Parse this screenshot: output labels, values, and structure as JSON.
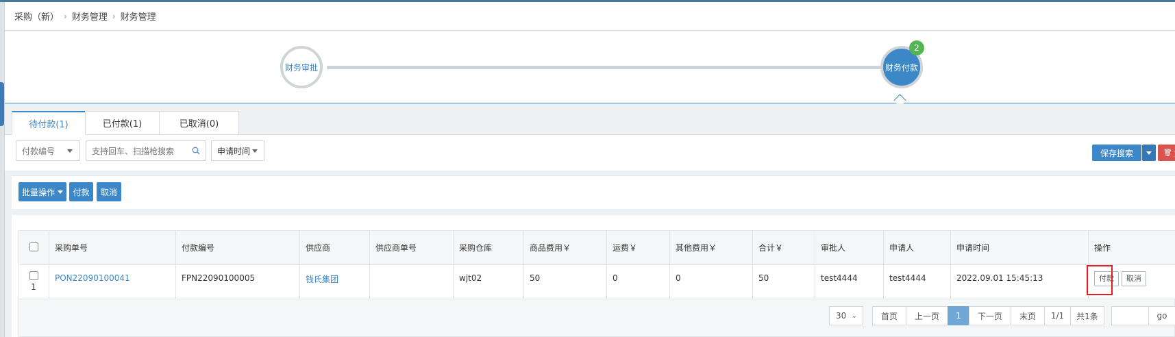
{
  "breadcrumb": [
    "采购（新）",
    "财务管理",
    "财务管理"
  ],
  "steps": [
    {
      "label": "财务审批"
    },
    {
      "label": "财务付款",
      "badge": "2"
    }
  ],
  "tabs": [
    {
      "label": "待付款(1)"
    },
    {
      "label": "已付款(1)"
    },
    {
      "label": "已取消(0)"
    }
  ],
  "filters": {
    "field_select": "付款编号",
    "search_placeholder": "支持回车、扫描枪搜索",
    "time_select": "申请时间",
    "save_search": "保存搜索",
    "clear_label": "清"
  },
  "actions": {
    "batch": "批量操作",
    "pay": "付款",
    "cancel": "取消"
  },
  "table": {
    "headers": [
      "采购单号",
      "付款编号",
      "供应商",
      "供应商单号",
      "采购仓库",
      "商品费用￥",
      "运费￥",
      "其他费用￥",
      "合计￥",
      "审批人",
      "申请人",
      "申请时间",
      "操作"
    ],
    "rows": [
      {
        "index": "1",
        "po_number": "PON22090100041",
        "payment_number": "FPN22090100005",
        "supplier": "钱氏集团",
        "supplier_order": "",
        "warehouse": "wjt02",
        "goods_fee": "50",
        "freight": "0",
        "other_fee": "0",
        "total": "50",
        "approver": "test4444",
        "applicant": "test4444",
        "apply_time": "2022.09.01 15:45:13",
        "op_pay": "付款",
        "op_cancel": "取消"
      }
    ]
  },
  "pagination": {
    "page_size": "30",
    "first": "首页",
    "prev": "上一页",
    "current": "1",
    "next": "下一页",
    "last": "末页",
    "pages": "1/1",
    "total": "共1条",
    "go": "go"
  }
}
